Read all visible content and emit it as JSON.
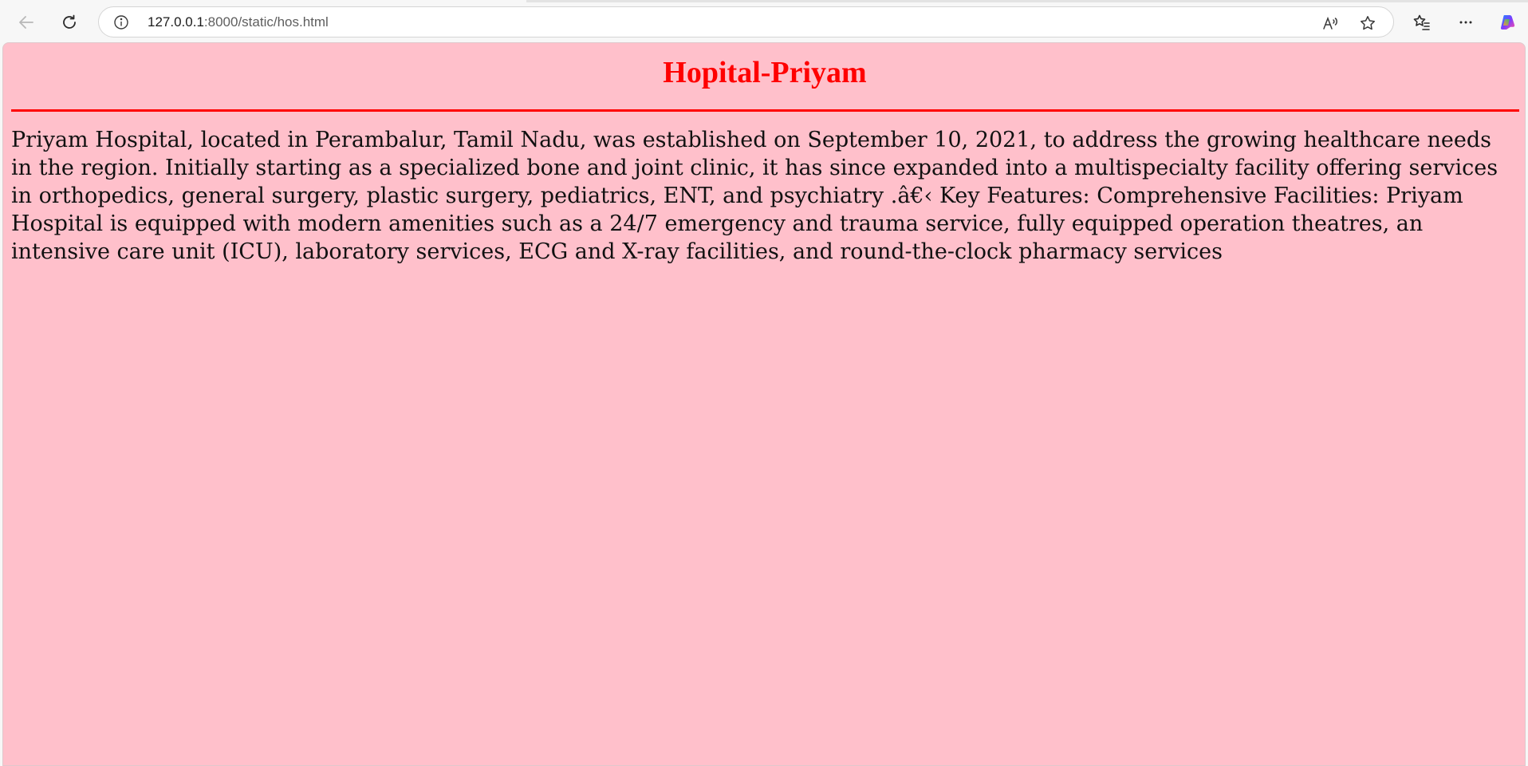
{
  "browser": {
    "url_host": "127.0.0.1",
    "url_rest": ":8000/static/hos.html",
    "icons": [
      "back-icon",
      "reload-icon",
      "site-info-icon",
      "read-aloud-icon",
      "favorite-star-icon",
      "favorites-icon",
      "more-icon",
      "copilot-icon"
    ]
  },
  "page": {
    "title": "Hopital-Priyam",
    "paragraph": "Priyam Hospital, located in Perambalur, Tamil Nadu, was established on September 10, 2021, to address the growing healthcare needs in the region. Initially starting as a specialized bone and joint clinic, it has since expanded into a multispecialty facility offering services in orthopedics, general surgery, plastic surgery, pediatrics, ENT, and psychiatry .â€‹ Key Features: Comprehensive Facilities: Priyam Hospital is equipped with modern amenities such as a 24/7 emergency and trauma service, fully equipped operation theatres, an intensive care unit (ICU), laboratory services, ECG and X-ray facilities, and round-the-clock pharmacy services",
    "colors": {
      "background": "#ffc0cb",
      "title": "#ff0000",
      "rule": "#ff0000"
    }
  }
}
